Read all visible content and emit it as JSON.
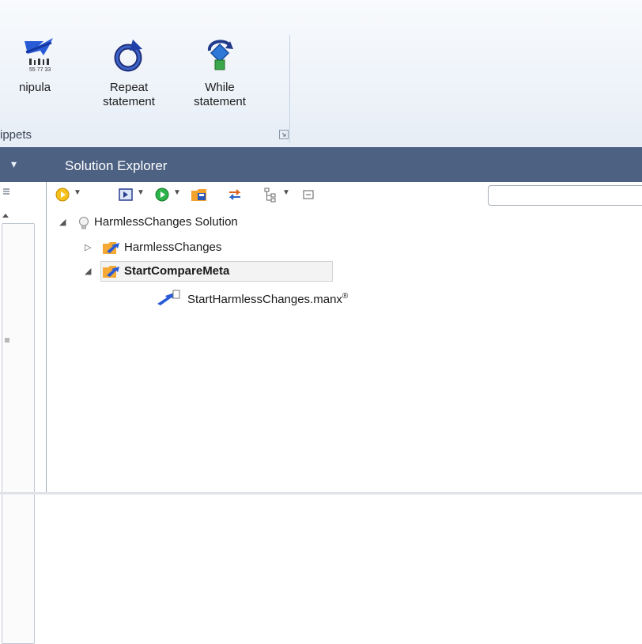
{
  "ribbon": {
    "buttons": [
      {
        "label": "nipula",
        "icon": "manipulation-icon"
      },
      {
        "label": "Repeat\nstatement",
        "icon": "repeat-icon"
      },
      {
        "label": "While\nstatement",
        "icon": "while-icon"
      }
    ],
    "group_label": "ippets"
  },
  "panel": {
    "title": "Solution Explorer"
  },
  "tree": {
    "solution": "HarmlessChanges Solution",
    "projects": [
      {
        "label": "HarmlessChanges",
        "expanded": false,
        "selected": false
      },
      {
        "label": "StartCompareMeta",
        "expanded": true,
        "selected": true
      }
    ],
    "file": "StartHarmlessChanges.manx",
    "file_marker": "®"
  },
  "colors": {
    "titlebar": "#4d6182",
    "ribbon": "#eef3f9"
  }
}
